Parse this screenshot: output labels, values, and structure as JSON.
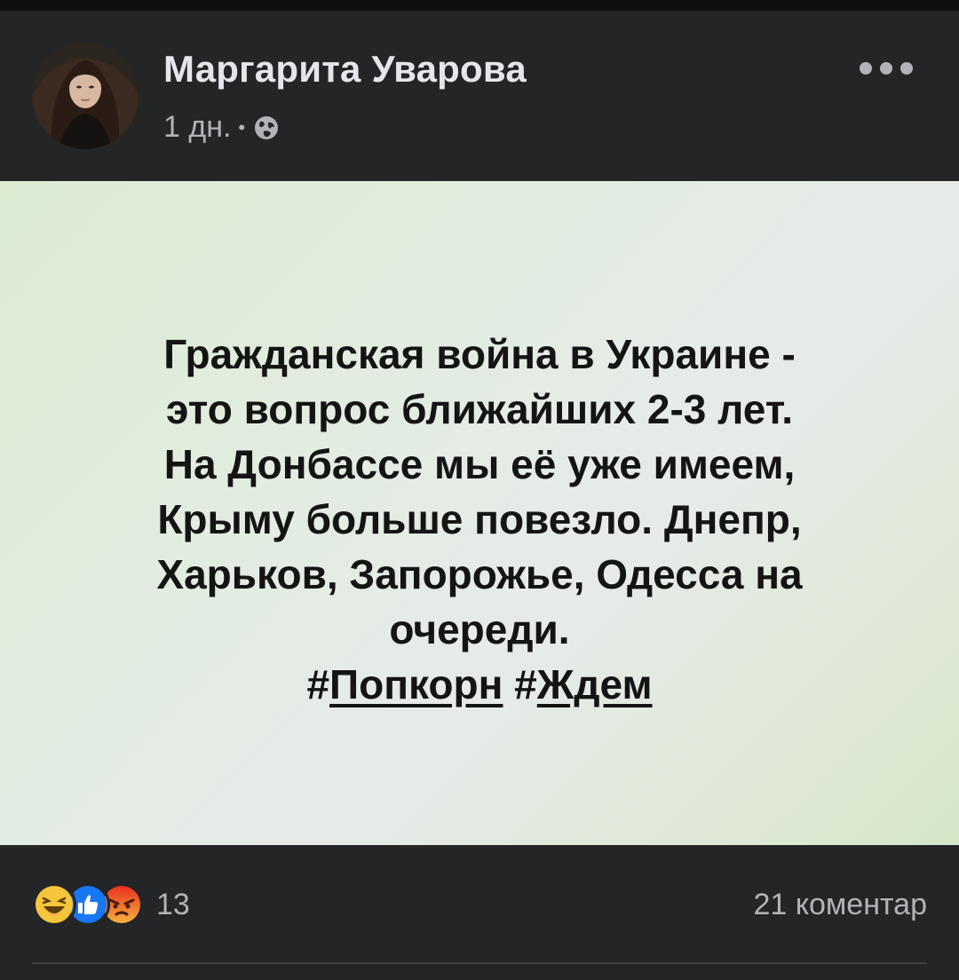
{
  "post": {
    "author_name": "Маргарита Уварова",
    "timestamp": "1 дн.",
    "separator": "•",
    "privacy_icon": "globe-icon",
    "more_icon": "more-options-icon",
    "content": {
      "lines": [
        "Гражданская война в Украине -",
        "это вопрос ближайших 2-3 лет.",
        "На Донбассе мы её уже имеем,",
        "Крыму больше повезло. Днепр,",
        "Харьков, Запорожье, Одесса на",
        "очереди."
      ],
      "hashtags": [
        "Попкорн",
        "Ждем"
      ],
      "hash_symbol": "#"
    },
    "reactions": {
      "icons": [
        "haha-icon",
        "like-icon",
        "angry-icon"
      ],
      "count": "13"
    },
    "comments_label": "21 коментар"
  },
  "colors": {
    "page_bg": "#242526",
    "text_primary": "#e4e6eb",
    "text_secondary": "#b0b3b8",
    "card_bg": "#e0ebdb",
    "like_blue": "#1877f2",
    "haha_yellow": "#f7c53c",
    "angry_orange": "#e9710f"
  }
}
